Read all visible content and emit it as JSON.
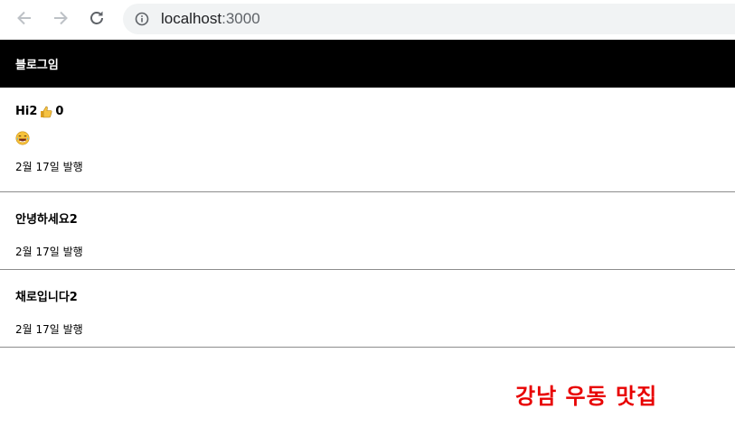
{
  "browser": {
    "url_host": "localhost",
    "url_port": ":3000"
  },
  "nav": {
    "title": "블로그임"
  },
  "posts": [
    {
      "title": "Hi2",
      "likes": "0",
      "emoji": "😂",
      "date": "2월 17일 발행"
    },
    {
      "title": "안녕하세요2",
      "date": "2월 17일 발행"
    },
    {
      "title": "채로입니다2",
      "date": "2월 17일 발행"
    }
  ],
  "promo": {
    "text": "강남 우동 맛집",
    "color": "#e80000"
  },
  "colors": {
    "nav_bg": "#000000",
    "nav_text": "#ffffff",
    "divider": "#8c8c8c"
  }
}
